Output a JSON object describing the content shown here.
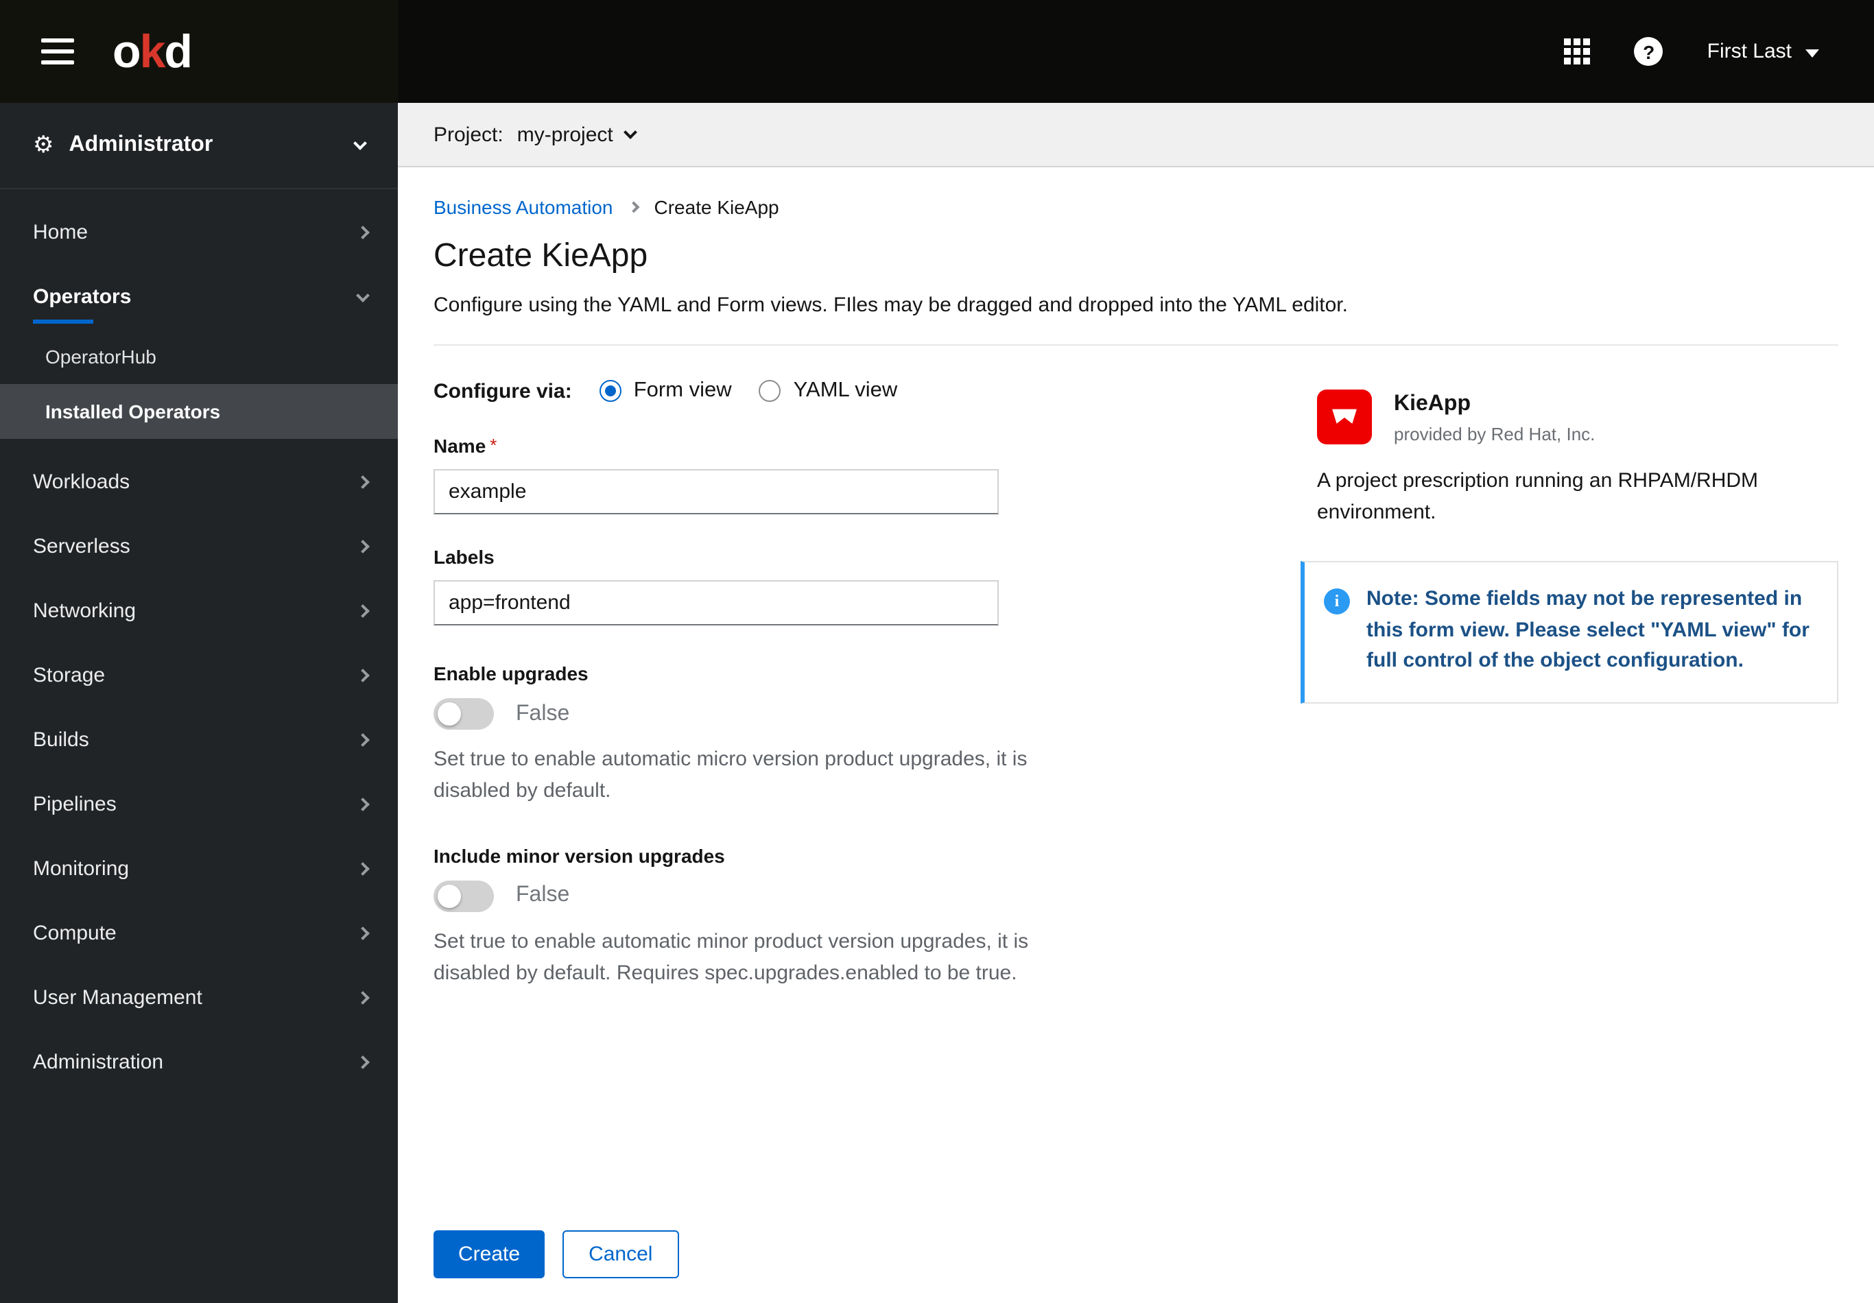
{
  "colors": {
    "accent": "#0066cc",
    "masthead-bg": "#0b0b09",
    "sidebar-bg": "#212427",
    "sidebar-active-bg": "#43474b",
    "required": "#c9190b",
    "info": "#2b9af3",
    "note-title": "#1b5186",
    "logo-red": "#ee0000"
  },
  "masthead": {
    "logo_parts": {
      "o": "o",
      "k": "k",
      "d": "d"
    },
    "user": "First Last",
    "help_glyph": "?"
  },
  "sidebar": {
    "perspective": "Administrator",
    "items": [
      {
        "label": "Home"
      },
      {
        "label": "Operators",
        "children": [
          {
            "label": "OperatorHub"
          },
          {
            "label": "Installed Operators"
          }
        ]
      },
      {
        "label": "Workloads"
      },
      {
        "label": "Serverless"
      },
      {
        "label": "Networking"
      },
      {
        "label": "Storage"
      },
      {
        "label": "Builds"
      },
      {
        "label": "Pipelines"
      },
      {
        "label": "Monitoring"
      },
      {
        "label": "Compute"
      },
      {
        "label": "User Management"
      },
      {
        "label": "Administration"
      }
    ]
  },
  "project_bar": {
    "label": "Project:",
    "value": "my-project"
  },
  "breadcrumb": {
    "parent": "Business Automation",
    "current": "Create KieApp"
  },
  "page": {
    "title": "Create KieApp",
    "description": "Configure using the YAML and Form views. FIles may be dragged and dropped into the YAML editor."
  },
  "configure_via": {
    "label": "Configure via:",
    "options": [
      {
        "label": "Form view",
        "selected": true
      },
      {
        "label": "YAML view",
        "selected": false
      }
    ]
  },
  "form": {
    "name": {
      "label": "Name",
      "required_marker": "*",
      "value": "example"
    },
    "labels": {
      "label": "Labels",
      "value": "app=frontend"
    },
    "enable_upgrades": {
      "label": "Enable upgrades",
      "state_label": "False",
      "help": "Set true to enable automatic micro version product upgrades, it is disabled by default."
    },
    "minor_upgrades": {
      "label": "Include minor version upgrades",
      "state_label": "False",
      "help": "Set true to enable automatic minor product version upgrades, it is disabled by default. Requires spec.upgrades.enabled to be true."
    },
    "actions": {
      "create": "Create",
      "cancel": "Cancel"
    }
  },
  "side_panel": {
    "title": "KieApp",
    "provider": "provided by Red Hat, Inc.",
    "description": "A project prescription running an RHPAM/RHDM environment.",
    "note": "Note: Some fields may not be represented in this form view. Please select \"YAML view\" for full control of the object configuration."
  }
}
